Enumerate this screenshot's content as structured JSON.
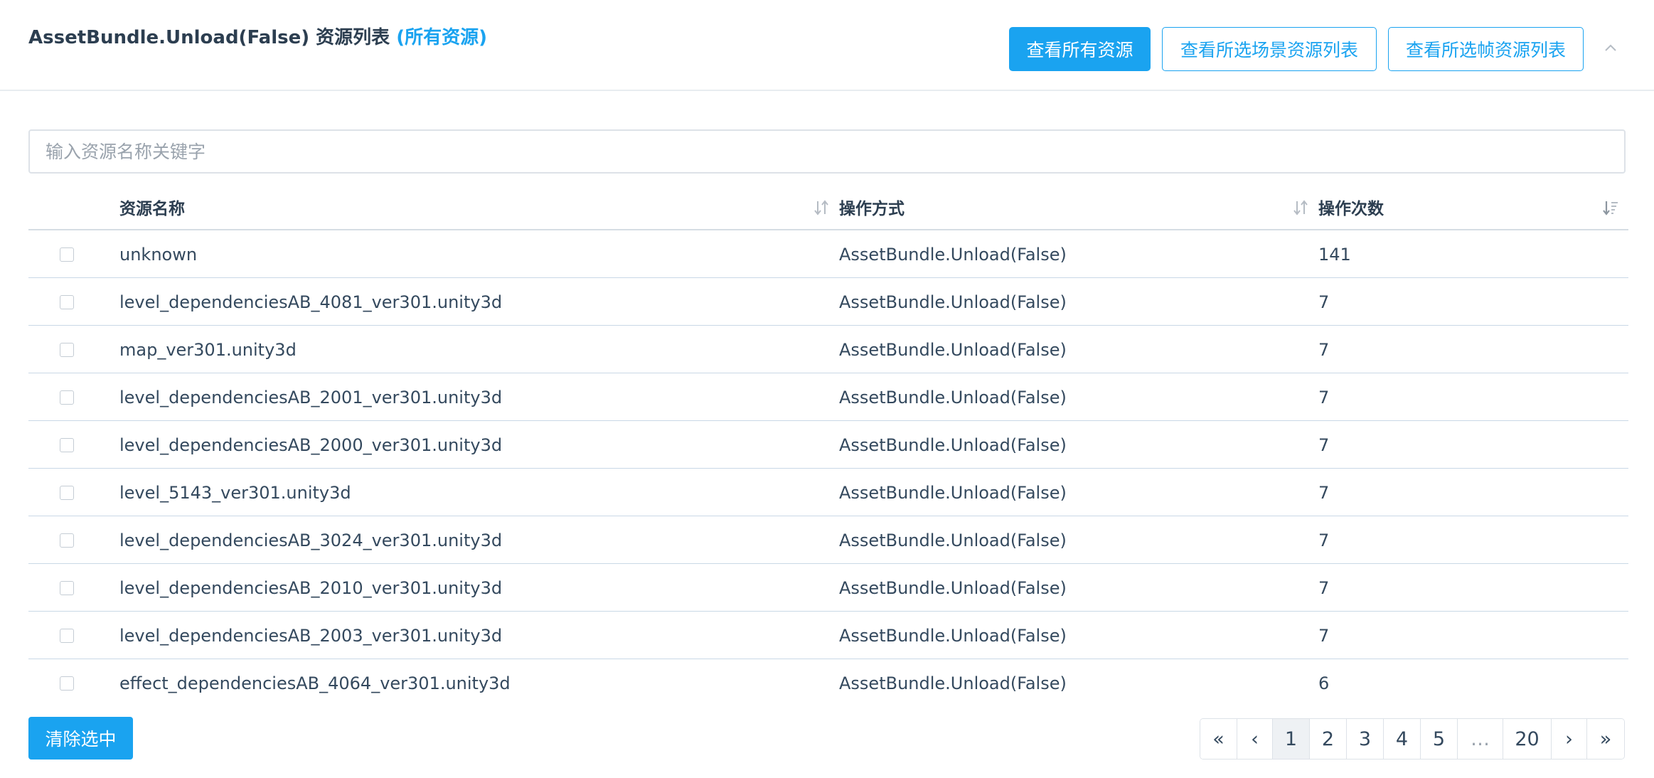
{
  "header": {
    "title": "AssetBundle.Unload(False) 资源列表",
    "title_highlight": "(所有资源)",
    "buttons": {
      "all_resources": "查看所有资源",
      "scene_resources": "查看所选场景资源列表",
      "frame_resources": "查看所选帧资源列表"
    },
    "collapse_icon": "chevron-up-icon"
  },
  "search": {
    "placeholder": "输入资源名称关键字",
    "value": ""
  },
  "table": {
    "columns": {
      "name": "资源名称",
      "method": "操作方式",
      "count": "操作次数"
    },
    "sort_icons": {
      "name": "sort-both-icon",
      "method": "sort-both-icon",
      "count": "sort-desc-icon"
    },
    "rows": [
      {
        "name": "unknown",
        "method": "AssetBundle.Unload(False)",
        "count": "141"
      },
      {
        "name": "level_dependenciesAB_4081_ver301.unity3d",
        "method": "AssetBundle.Unload(False)",
        "count": "7"
      },
      {
        "name": "map_ver301.unity3d",
        "method": "AssetBundle.Unload(False)",
        "count": "7"
      },
      {
        "name": "level_dependenciesAB_2001_ver301.unity3d",
        "method": "AssetBundle.Unload(False)",
        "count": "7"
      },
      {
        "name": "level_dependenciesAB_2000_ver301.unity3d",
        "method": "AssetBundle.Unload(False)",
        "count": "7"
      },
      {
        "name": "level_5143_ver301.unity3d",
        "method": "AssetBundle.Unload(False)",
        "count": "7"
      },
      {
        "name": "level_dependenciesAB_3024_ver301.unity3d",
        "method": "AssetBundle.Unload(False)",
        "count": "7"
      },
      {
        "name": "level_dependenciesAB_2010_ver301.unity3d",
        "method": "AssetBundle.Unload(False)",
        "count": "7"
      },
      {
        "name": "level_dependenciesAB_2003_ver301.unity3d",
        "method": "AssetBundle.Unload(False)",
        "count": "7"
      },
      {
        "name": "effect_dependenciesAB_4064_ver301.unity3d",
        "method": "AssetBundle.Unload(False)",
        "count": "6"
      }
    ]
  },
  "footer": {
    "clear_selection": "清除选中"
  },
  "pagination": {
    "first": "«",
    "prev": "‹",
    "pages": [
      "1",
      "2",
      "3",
      "4",
      "5"
    ],
    "ellipsis": "…",
    "last_page": "20",
    "next": "›",
    "last": "»",
    "current": "1"
  },
  "colors": {
    "accent": "#1aa3f0",
    "text": "#34495e",
    "border": "#dde2e8"
  }
}
